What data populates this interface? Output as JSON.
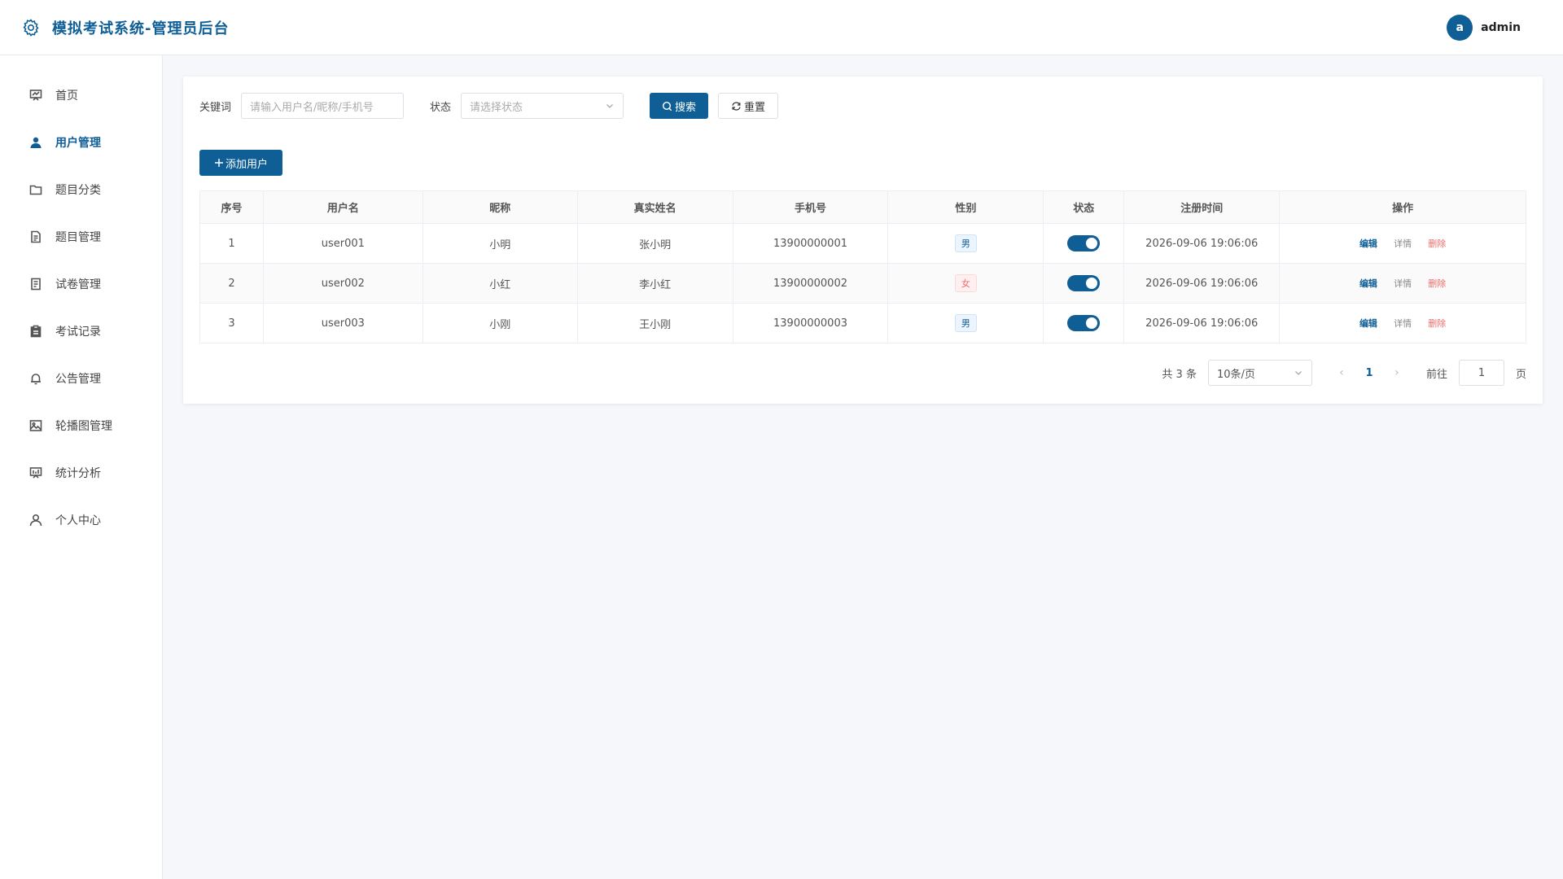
{
  "header": {
    "title": "模拟考试系统-管理员后台",
    "avatar_letter": "a",
    "username": "admin"
  },
  "sidebar": {
    "items": [
      {
        "label": "首页",
        "icon": "dashboard-icon"
      },
      {
        "label": "用户管理",
        "icon": "user-icon",
        "active": true
      },
      {
        "label": "题目分类",
        "icon": "folder-icon"
      },
      {
        "label": "题目管理",
        "icon": "document-icon"
      },
      {
        "label": "试卷管理",
        "icon": "paper-icon"
      },
      {
        "label": "考试记录",
        "icon": "clipboard-icon"
      },
      {
        "label": "公告管理",
        "icon": "bell-icon"
      },
      {
        "label": "轮播图管理",
        "icon": "picture-icon"
      },
      {
        "label": "统计分析",
        "icon": "chart-board-icon"
      },
      {
        "label": "个人中心",
        "icon": "person-icon"
      }
    ]
  },
  "filters": {
    "keyword_label": "关键词",
    "keyword_placeholder": "请输入用户名/昵称/手机号",
    "status_label": "状态",
    "status_placeholder": "请选择状态",
    "search_label": "搜索",
    "reset_label": "重置"
  },
  "toolbar": {
    "add_user_label": "添加用户"
  },
  "table": {
    "headers": [
      "序号",
      "用户名",
      "昵称",
      "真实姓名",
      "手机号",
      "性别",
      "状态",
      "注册时间",
      "操作"
    ],
    "rows": [
      {
        "index": "1",
        "username": "user001",
        "nickname": "小明",
        "realname": "张小明",
        "phone": "13900000001",
        "gender": "男",
        "gender_type": "male",
        "enabled": true,
        "registered": "2026-09-06 19:06:06"
      },
      {
        "index": "2",
        "username": "user002",
        "nickname": "小红",
        "realname": "李小红",
        "phone": "13900000002",
        "gender": "女",
        "gender_type": "female",
        "enabled": true,
        "registered": "2026-09-06 19:06:06"
      },
      {
        "index": "3",
        "username": "user003",
        "nickname": "小刚",
        "realname": "王小刚",
        "phone": "13900000003",
        "gender": "男",
        "gender_type": "male",
        "enabled": true,
        "registered": "2026-09-06 19:06:06"
      }
    ],
    "actions": {
      "edit": "编辑",
      "detail": "详情",
      "delete": "删除"
    }
  },
  "pagination": {
    "total_text": "共 3 条",
    "page_size": "10条/页",
    "current_page": "1",
    "goto_label": "前往",
    "goto_value": "1",
    "page_suffix": "页"
  },
  "colors": {
    "primary": "#0f5f96",
    "danger": "#f56c6c"
  }
}
